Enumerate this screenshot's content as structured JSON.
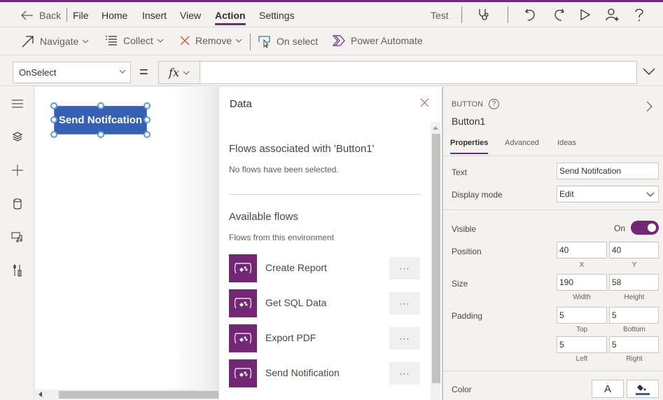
{
  "menubar": {
    "back_label": "Back",
    "items": [
      "File",
      "Home",
      "Insert",
      "View",
      "Action",
      "Settings"
    ],
    "active_item": "Action",
    "test_label": "Test",
    "icons": [
      "stethoscope-icon",
      "undo-icon",
      "redo-icon",
      "play-icon",
      "share-user-icon",
      "help-icon"
    ]
  },
  "toolbar": {
    "navigate_label": "Navigate",
    "collect_label": "Collect",
    "remove_label": "Remove",
    "on_select_label": "On select",
    "power_automate_label": "Power Automate"
  },
  "formula_bar": {
    "property": "OnSelect",
    "equals": "=",
    "fx_label": "fx",
    "formula_value": ""
  },
  "canvas": {
    "button_text": "Send Notifcation",
    "button_color": "#3560b5"
  },
  "data_panel": {
    "title": "Data",
    "associated_title": "Flows associated with 'Button1'",
    "associated_empty": "No flows have been selected.",
    "available_title": "Available flows",
    "available_sub": "Flows from this environment",
    "more_label": "···",
    "flows": [
      {
        "name": "Create Report"
      },
      {
        "name": "Get SQL Data"
      },
      {
        "name": "Export PDF"
      },
      {
        "name": "Send Notification"
      }
    ]
  },
  "properties_panel": {
    "control_type": "BUTTON",
    "help_glyph": "?",
    "control_name": "Button1",
    "tabs": [
      "Properties",
      "Advanced",
      "Ideas"
    ],
    "active_tab": "Properties",
    "text_label": "Text",
    "text_value": "Send Notifcation",
    "display_mode_label": "Display mode",
    "display_mode_value": "Edit",
    "visible_label": "Visible",
    "visible_state": "On",
    "position_label": "Position",
    "position_x": "40",
    "position_y": "40",
    "x_caption": "X",
    "y_caption": "Y",
    "size_label": "Size",
    "size_width": "190",
    "size_height": "58",
    "width_caption": "Width",
    "height_caption": "Height",
    "padding_label": "Padding",
    "padding_top": "5",
    "padding_bottom": "5",
    "padding_left": "5",
    "padding_right": "5",
    "top_caption": "Top",
    "bottom_caption": "Bottom",
    "left_caption": "Left",
    "right_caption": "Right",
    "color_label": "Color",
    "text_color_glyph": "A",
    "fill_color": "#3560b5"
  },
  "colors": {
    "accent": "#742774",
    "button_fill": "#3560b5"
  }
}
